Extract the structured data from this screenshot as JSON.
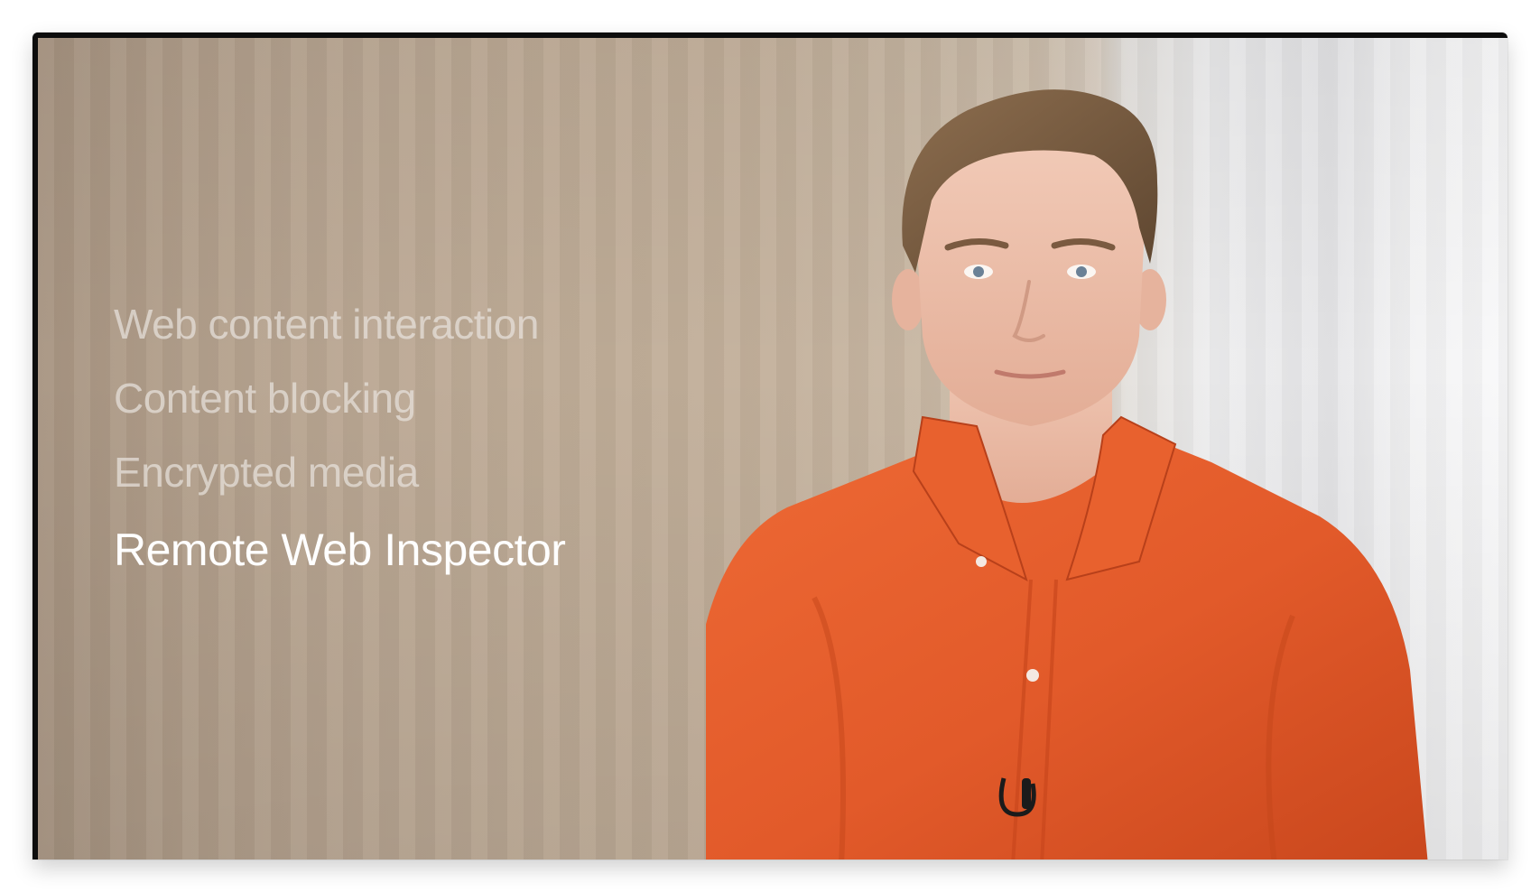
{
  "slide": {
    "bullets": [
      {
        "label": "Web content interaction",
        "active": false
      },
      {
        "label": "Content blocking",
        "active": false
      },
      {
        "label": "Encrypted media",
        "active": false
      },
      {
        "label": "Remote Web Inspector",
        "active": true
      }
    ]
  },
  "colors": {
    "shirt": "#e25a2a",
    "background_wall": "#bba894",
    "active_text": "#ffffff",
    "inactive_text": "#e8e2dc"
  }
}
